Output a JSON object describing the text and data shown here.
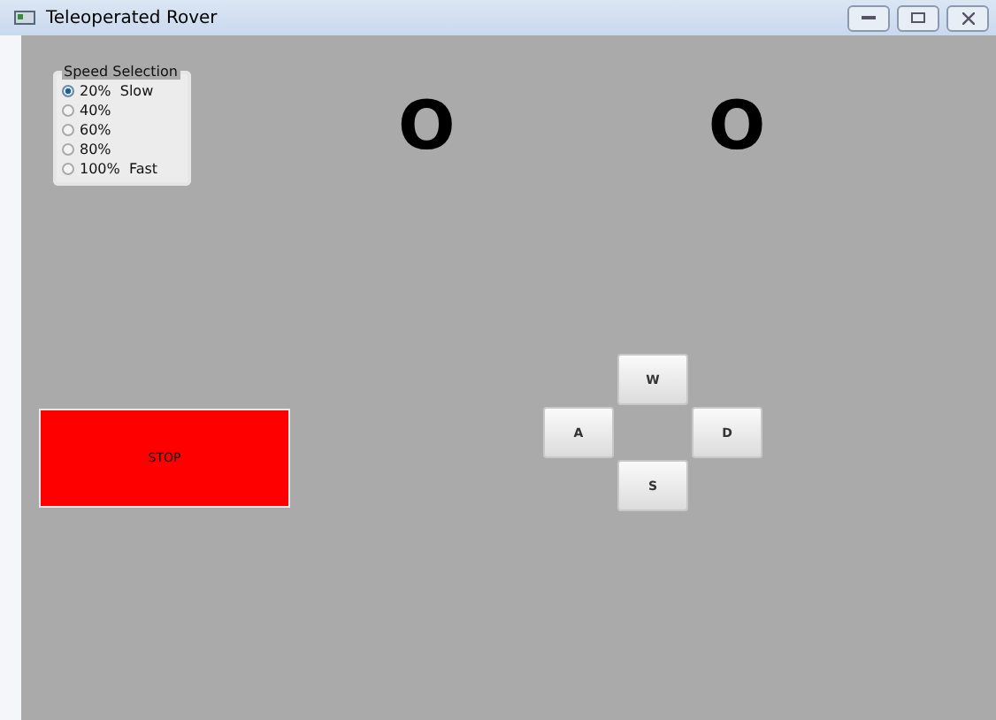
{
  "window": {
    "title": "Teleoperated Rover"
  },
  "speed_selection": {
    "title": "Speed Selection",
    "options": [
      {
        "label": "20%  Slow",
        "selected": true
      },
      {
        "label": "40%",
        "selected": false
      },
      {
        "label": "60%",
        "selected": false
      },
      {
        "label": "80%",
        "selected": false
      },
      {
        "label": "100%  Fast",
        "selected": false
      }
    ]
  },
  "indicators": [
    "O",
    "O"
  ],
  "stop_button": "STOP",
  "direction_buttons": {
    "up": "W",
    "left": "A",
    "right": "D",
    "down": "S"
  }
}
